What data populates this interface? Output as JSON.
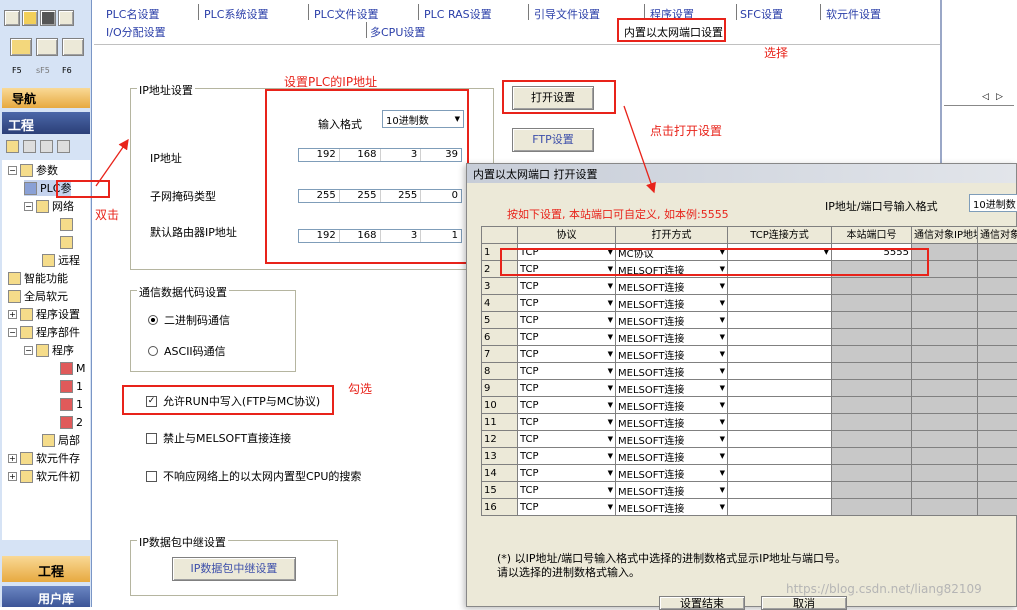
{
  "tabs_row1": [
    "PLC名设置",
    "PLC系统设置",
    "PLC文件设置",
    "PLC RAS设置",
    "引导文件设置",
    "程序设置",
    "SFC设置",
    "软元件设置"
  ],
  "tabs_row2": [
    "I/O分配设置",
    "多CPU设置",
    "内置以太网端口设置"
  ],
  "left": {
    "nav": "导航",
    "project": "工程",
    "bottom_project": "工程",
    "bottom_user": "用户库",
    "tree": {
      "params": "参数",
      "plc": "PLC参",
      "network": "网络",
      "remote": "远程",
      "smart": "智能功能",
      "global": "全局软元",
      "program_setting": "程序设置",
      "program_parts": "程序部件",
      "program": "程序",
      "local": "局部",
      "devmem": "软元件存",
      "devinit": "软元件初"
    },
    "tree_sub": [
      "M",
      "1",
      "1",
      "2"
    ]
  },
  "ip_group": {
    "legend": "IP地址设置",
    "input_format_label": "输入格式",
    "input_format_value": "10进制数",
    "ip_label": "IP地址",
    "ip": [
      "192",
      "168",
      "3",
      "39"
    ],
    "subnet_label": "子网掩码类型",
    "subnet": [
      "255",
      "255",
      "255",
      "0"
    ],
    "gateway_label": "默认路由器IP地址",
    "gateway": [
      "192",
      "168",
      "3",
      "1"
    ]
  },
  "comm_group": {
    "legend": "通信数据代码设置",
    "binary": "二进制码通信",
    "ascii": "ASCII码通信"
  },
  "checks": {
    "allow_run_write": "允许RUN中写入(FTP与MC协议)",
    "prohibit_melsoft": "禁止与MELSOFT直接连接",
    "no_respond": "不响应网络上的以太网内置型CPU的搜索"
  },
  "relay_group": {
    "legend": "IP数据包中继设置",
    "button": "IP数据包中继设置"
  },
  "buttons": {
    "open_setting": "打开设置",
    "ftp_setting": "FTP设置"
  },
  "annotations": {
    "select": "选择",
    "set_ip": "设置PLC的IP地址",
    "click_open": "点击打开设置",
    "double_click": "双击",
    "check": "勾选",
    "instruction": "按如下设置, 本站端口可自定义, 如本例:5555"
  },
  "dialog": {
    "title": "内置以太网端口 打开设置",
    "format_label": "IP地址/端口号输入格式",
    "format_value": "10进制数",
    "headers": [
      "协议",
      "打开方式",
      "TCP连接方式",
      "本站端口号",
      "通信对象IP地址",
      "通信对象端口"
    ],
    "rows": [
      {
        "no": "1",
        "protocol": "TCP",
        "open": "MC协议",
        "port": "5555"
      },
      {
        "no": "2",
        "protocol": "TCP",
        "open": "MELSOFT连接",
        "port": ""
      },
      {
        "no": "3",
        "protocol": "TCP",
        "open": "MELSOFT连接",
        "port": ""
      },
      {
        "no": "4",
        "protocol": "TCP",
        "open": "MELSOFT连接",
        "port": ""
      },
      {
        "no": "5",
        "protocol": "TCP",
        "open": "MELSOFT连接",
        "port": ""
      },
      {
        "no": "6",
        "protocol": "TCP",
        "open": "MELSOFT连接",
        "port": ""
      },
      {
        "no": "7",
        "protocol": "TCP",
        "open": "MELSOFT连接",
        "port": ""
      },
      {
        "no": "8",
        "protocol": "TCP",
        "open": "MELSOFT连接",
        "port": ""
      },
      {
        "no": "9",
        "protocol": "TCP",
        "open": "MELSOFT连接",
        "port": ""
      },
      {
        "no": "10",
        "protocol": "TCP",
        "open": "MELSOFT连接",
        "port": ""
      },
      {
        "no": "11",
        "protocol": "TCP",
        "open": "MELSOFT连接",
        "port": ""
      },
      {
        "no": "12",
        "protocol": "TCP",
        "open": "MELSOFT连接",
        "port": ""
      },
      {
        "no": "13",
        "protocol": "TCP",
        "open": "MELSOFT连接",
        "port": ""
      },
      {
        "no": "14",
        "protocol": "TCP",
        "open": "MELSOFT连接",
        "port": ""
      },
      {
        "no": "15",
        "protocol": "TCP",
        "open": "MELSOFT连接",
        "port": ""
      },
      {
        "no": "16",
        "protocol": "TCP",
        "open": "MELSOFT连接",
        "port": ""
      }
    ],
    "note1": "(*) 以IP地址/端口号输入格式中选择的进制数格式显示IP地址与端口号。",
    "note2": "请以选择的进制数格式输入。",
    "ok": "设置结束",
    "cancel": "取消"
  },
  "watermark": "https://blog.csdn.net/liang82109"
}
